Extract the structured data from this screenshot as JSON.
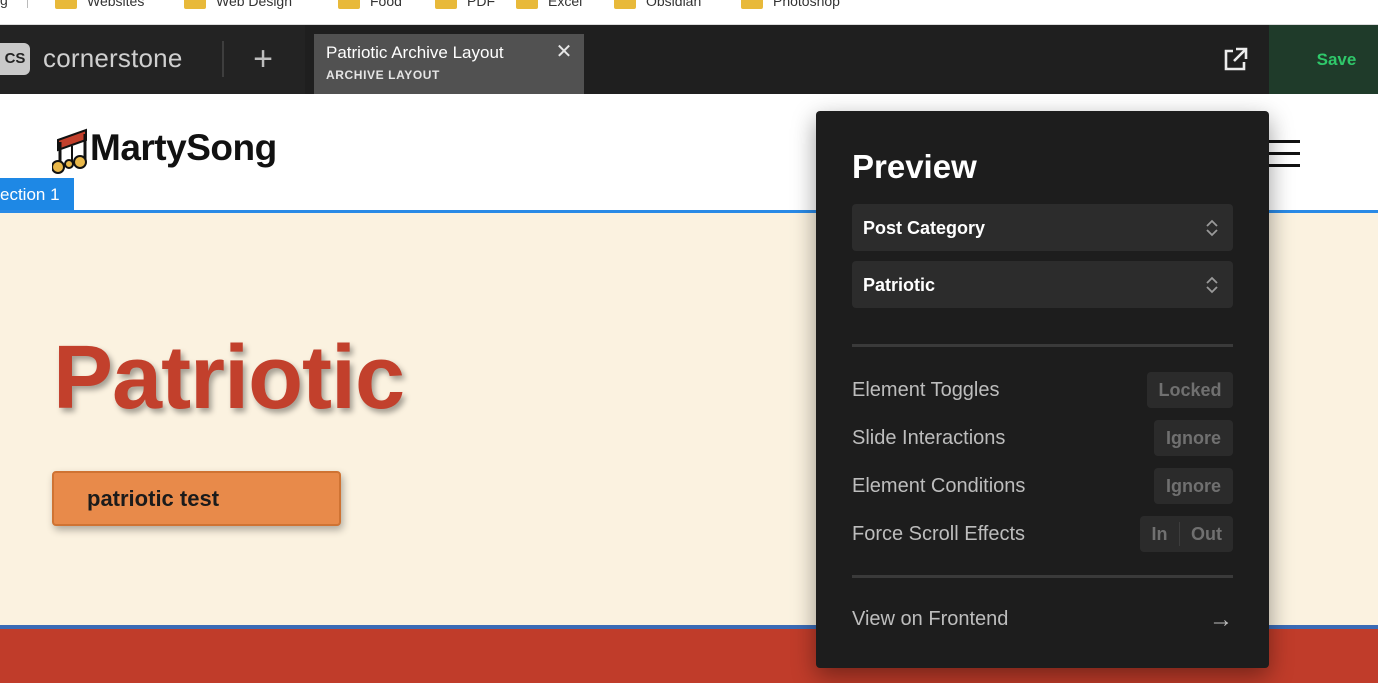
{
  "bookmarks_bar": {
    "edge_text": "g",
    "items": [
      "Websites",
      "Web Design",
      "Food",
      "PDF",
      "Excel",
      "Obsidian",
      "Photoshop"
    ]
  },
  "topbar": {
    "logo_badge": "CS",
    "app_name": "cornerstone",
    "add_symbol": "+",
    "tab": {
      "title": "Patriotic Archive Layout",
      "subtitle": "ARCHIVE LAYOUT",
      "close_symbol": "✕"
    },
    "save_label": "Save"
  },
  "site": {
    "logo_text": "MartySong",
    "section_label": "ection 1",
    "hero_title": "Patriotic",
    "hero_button": "patriotic test"
  },
  "preview_panel": {
    "title": "Preview",
    "selects": [
      {
        "value": "Post Category"
      },
      {
        "value": "Patriotic"
      }
    ],
    "rows": [
      {
        "label": "Element Toggles",
        "control": "Locked"
      },
      {
        "label": "Slide Interactions",
        "control": "Ignore"
      },
      {
        "label": "Element Conditions",
        "control": "Ignore"
      },
      {
        "label": "Force Scroll Effects",
        "options": [
          "In",
          "Out"
        ]
      }
    ],
    "frontend_link": "View on Frontend",
    "frontend_arrow": "→"
  },
  "colors": {
    "save_text": "#2fc86a",
    "hero_title": "#c2402c",
    "hero_bg": "#fbf2e0",
    "section_blue": "#1e88e5",
    "hero_button": "#e88a4a",
    "footer_band": "#c03c2a"
  },
  "icons": {
    "logo_icon": "music-note-icon",
    "external": "external-link-icon",
    "menu": "hamburger-menu-icon",
    "select_chevron": "chevron-up-down-icon"
  }
}
